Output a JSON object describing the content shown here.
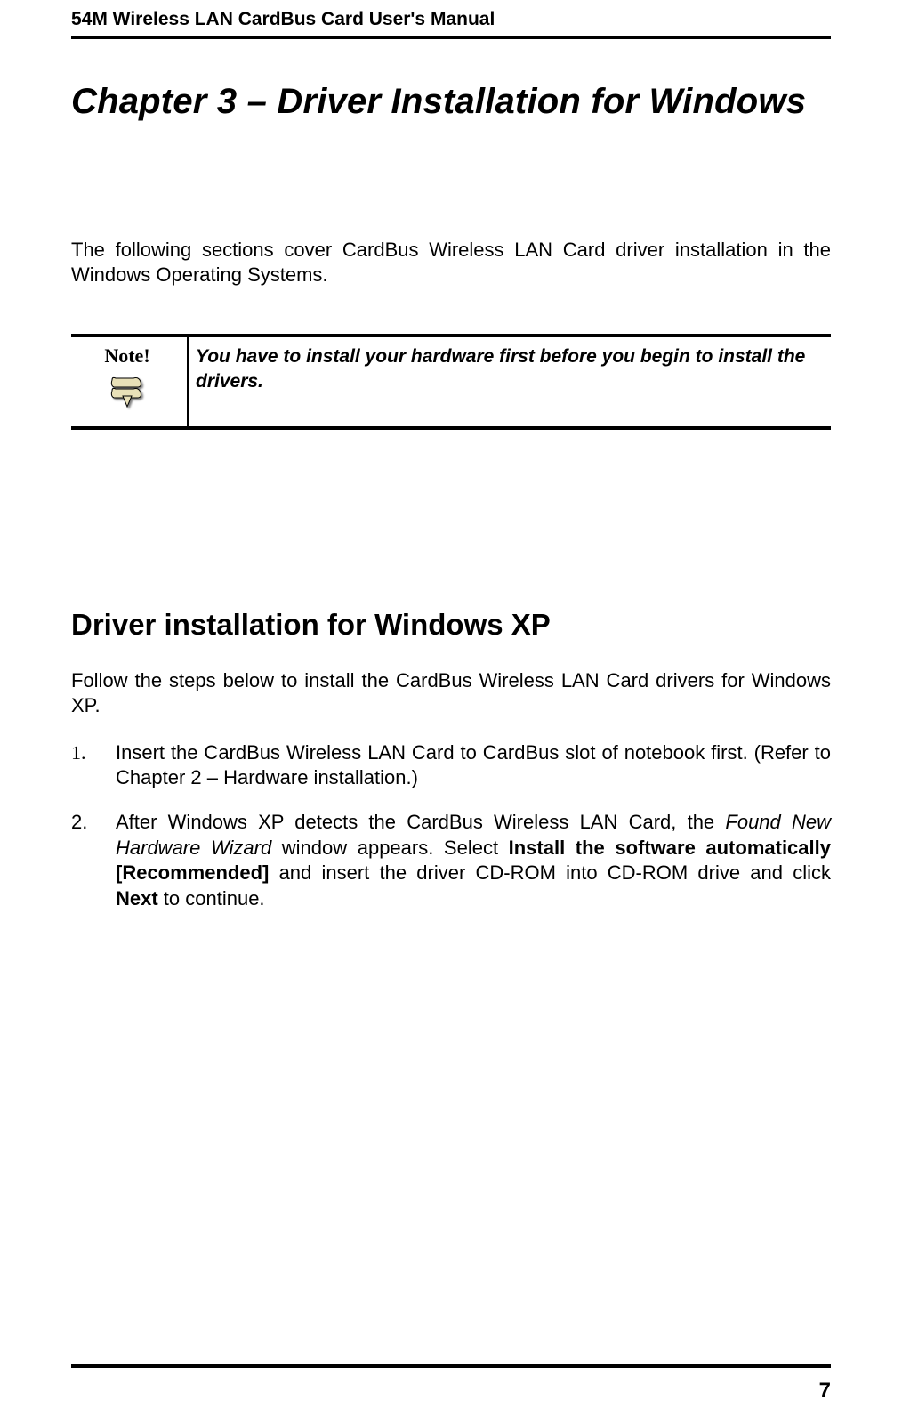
{
  "header": {
    "running_title": "54M Wireless LAN CardBus Card User's Manual"
  },
  "chapter": {
    "title": "Chapter 3 – Driver Installation for Windows"
  },
  "intro_paragraph": "The following sections cover CardBus Wireless LAN Card driver installation in the Windows Operating Systems.",
  "note": {
    "label": "Note!",
    "text": "You have to install your hardware first before you begin to install the drivers."
  },
  "section": {
    "title": "Driver installation for Windows XP",
    "lead": "Follow the steps below to install the CardBus Wireless LAN Card drivers for Windows XP.",
    "steps": {
      "step1": "Insert the CardBus Wireless LAN Card to CardBus slot of notebook first. (Refer to Chapter 2 – Hardware installation.)",
      "step2": {
        "t1": "After Windows XP detects the CardBus Wireless LAN Card, the ",
        "italic1": "Found New Hardware Wizard",
        "t2": " window appears.  Select ",
        "bold1": "Install the software automatically [Recommended]",
        "t3": " and insert the driver CD-ROM into CD-ROM drive and click ",
        "bold2": "Next",
        "t4": " to continue."
      }
    }
  },
  "footer": {
    "page_number": "7"
  }
}
